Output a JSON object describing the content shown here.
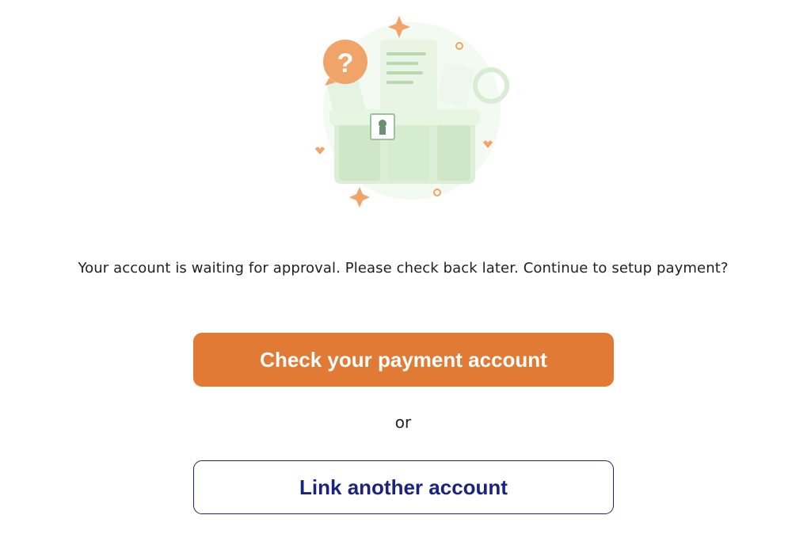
{
  "illustration": {
    "icon": "document-box-question-icon",
    "question_glyph": "?",
    "colors": {
      "accent": "#f0a46a",
      "green_light": "#e3f2df",
      "green_mid": "#cfe8c8",
      "green_dark": "#b5d8ac"
    }
  },
  "status": {
    "message": "Your account is waiting for approval. Please check back later. Continue to setup payment?"
  },
  "actions": {
    "primary_label": "Check your payment account",
    "separator": "or",
    "secondary_label": "Link another account"
  },
  "colors": {
    "primary_button": "#e07a34",
    "secondary_button_text": "#1a237e"
  }
}
